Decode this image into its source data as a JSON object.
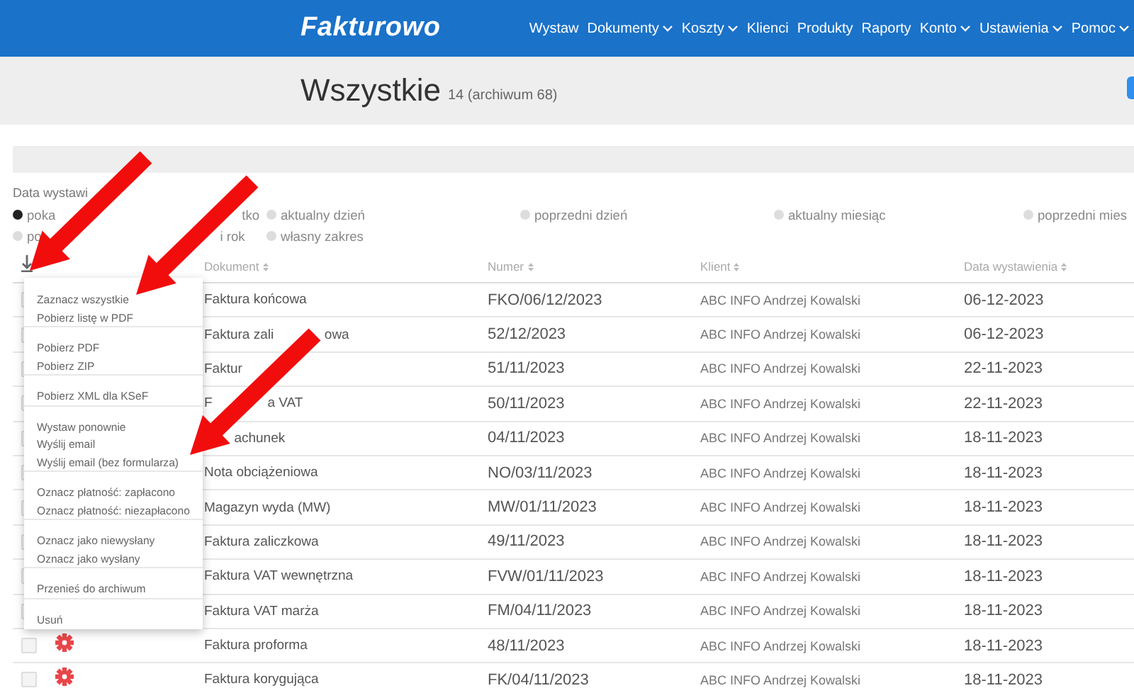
{
  "navbar": {
    "logo": "Fakturowo",
    "items": [
      {
        "label": "Wystaw",
        "has_menu": false
      },
      {
        "label": "Dokumenty",
        "has_menu": true
      },
      {
        "label": "Koszty",
        "has_menu": true
      },
      {
        "label": "Klienci",
        "has_menu": false
      },
      {
        "label": "Produkty",
        "has_menu": false
      },
      {
        "label": "Raporty",
        "has_menu": false
      },
      {
        "label": "Konto",
        "has_menu": true
      },
      {
        "label": "Ustawienia",
        "has_menu": true
      },
      {
        "label": "Pomoc",
        "has_menu": true
      }
    ]
  },
  "header": {
    "title": "Wszystkie",
    "count": "14 (archiwum 68)"
  },
  "filter": {
    "label": "Data wystawi",
    "options": [
      {
        "label": [
          "poka",
          "tko"
        ],
        "selected": true
      },
      {
        "label": "aktualny dzień",
        "selected": false
      },
      {
        "label": "poprzedni dzień",
        "selected": false
      },
      {
        "label": "aktualny miesiąc",
        "selected": false
      },
      {
        "label": "poprzedni mies",
        "selected": false
      },
      {
        "label": [
          "po",
          "i rok"
        ],
        "selected": false
      },
      {
        "label": "własny zakres",
        "selected": false
      }
    ]
  },
  "table": {
    "columns": [
      "Dokument",
      "Numer",
      "Klient",
      "Data wystawienia"
    ],
    "rows": [
      {
        "document": "Faktura końcowa",
        "number": "FKO/06/12/2023",
        "client": "ABC INFO Andrzej Kowalski",
        "date": "06-12-2023",
        "checked": false
      },
      {
        "document": [
          "Faktura zali",
          "owa"
        ],
        "number": "52/12/2023",
        "client": "ABC INFO Andrzej Kowalski",
        "date": "06-12-2023",
        "checked": false
      },
      {
        "document": "Faktur",
        "number": "51/11/2023",
        "client": "ABC INFO Andrzej Kowalski",
        "date": "22-11-2023",
        "checked": false
      },
      {
        "document": [
          "F",
          "a VAT"
        ],
        "number": "50/11/2023",
        "client": "ABC INFO Andrzej Kowalski",
        "date": "22-11-2023",
        "checked": false
      },
      {
        "document": "achunek",
        "lead_hidden": true,
        "number": "04/11/2023",
        "client": "ABC INFO Andrzej Kowalski",
        "date": "18-11-2023",
        "checked": false
      },
      {
        "document": "Nota obciążeniowa",
        "number": "NO/03/11/2023",
        "client": "ABC INFO Andrzej Kowalski",
        "date": "18-11-2023",
        "checked": false
      },
      {
        "document": "Magazyn wyda (MW)",
        "number": "MW/01/11/2023",
        "client": "ABC INFO Andrzej Kowalski",
        "date": "18-11-2023",
        "checked": false
      },
      {
        "document": "Faktura zaliczkowa",
        "number": "49/11/2023",
        "client": "ABC INFO Andrzej Kowalski",
        "date": "18-11-2023",
        "checked": false
      },
      {
        "document": "Faktura VAT wewnętrzna",
        "number": "FVW/01/11/2023",
        "client": "ABC INFO Andrzej Kowalski",
        "date": "18-11-2023",
        "checked": false
      },
      {
        "document": "Faktura VAT marża",
        "number": "FM/04/11/2023",
        "client": "ABC INFO Andrzej Kowalski",
        "date": "18-11-2023",
        "checked": false
      },
      {
        "document": "Faktura proforma",
        "number": "48/11/2023",
        "client": "ABC INFO Andrzej Kowalski",
        "date": "18-11-2023",
        "checked": false
      },
      {
        "document": "Faktura korygująca",
        "number": "FK/04/11/2023",
        "client": "ABC INFO Andrzej Kowalski",
        "date": "18-11-2023",
        "checked": false
      }
    ]
  },
  "bulk_menu": {
    "groups": [
      [
        "Zaznacz wszystkie",
        "Pobierz listę w PDF"
      ],
      [
        "Pobierz PDF",
        "Pobierz ZIP"
      ],
      [
        "Pobierz XML dla KSeF"
      ],
      [
        "Wystaw ponownie",
        "Wyślij email",
        "Wyślij email (bez formularza)"
      ],
      [
        "Oznacz płatność: zapłacono",
        "Oznacz płatność: niezapłacono"
      ],
      [
        "Oznacz jako niewysłany",
        "Oznacz jako wysłany"
      ],
      [
        "Przenieś do archiwum"
      ],
      [
        "Usuń"
      ]
    ]
  }
}
